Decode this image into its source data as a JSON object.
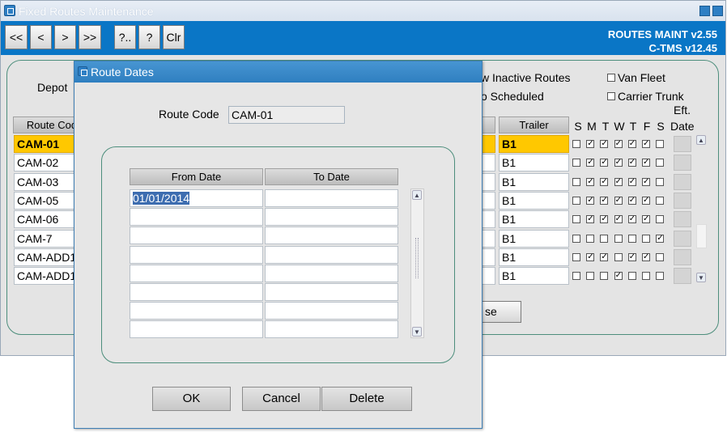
{
  "main_window": {
    "title": "Fixed Routes Maintenance",
    "toolbar": {
      "buttons": [
        "<<",
        "<",
        ">",
        ">>",
        "?..",
        "?",
        "Clr"
      ],
      "version_line1": "ROUTES  MAINT v2.55",
      "version_line2": "C-TMS v12.45"
    },
    "depot_label": "Depot",
    "show_inactive_label": "w Inactive Routes",
    "scheduled_label": "o Scheduled",
    "van_fleet_label": "Van Fleet",
    "carrier_trunk_label": "Carrier Trunk",
    "eft_date_label_1": "Eft.",
    "eft_date_label_2": "Date",
    "route_code_header": "Route Cod",
    "trailer_header": "Trailer",
    "days_header": [
      "S",
      "M",
      "T",
      "W",
      "T",
      "F",
      "S"
    ],
    "rows": [
      {
        "route": "CAM-01",
        "trailer": "B1",
        "days": [
          false,
          true,
          true,
          true,
          true,
          true,
          false
        ],
        "selected": true
      },
      {
        "route": "CAM-02",
        "trailer": "B1",
        "days": [
          false,
          true,
          true,
          true,
          true,
          true,
          false
        ],
        "selected": false
      },
      {
        "route": "CAM-03",
        "trailer": "B1",
        "days": [
          false,
          true,
          true,
          true,
          true,
          true,
          false
        ],
        "selected": false
      },
      {
        "route": "CAM-05",
        "trailer": "B1",
        "days": [
          false,
          true,
          true,
          true,
          true,
          true,
          false
        ],
        "selected": false
      },
      {
        "route": "CAM-06",
        "trailer": "B1",
        "days": [
          false,
          true,
          true,
          true,
          true,
          true,
          false
        ],
        "selected": false
      },
      {
        "route": "CAM-7",
        "trailer": "B1",
        "days": [
          false,
          false,
          false,
          false,
          false,
          false,
          true
        ],
        "selected": false
      },
      {
        "route": "CAM-ADD1",
        "trailer": "B1",
        "days": [
          false,
          true,
          true,
          false,
          true,
          true,
          false
        ],
        "selected": false
      },
      {
        "route": "CAM-ADD1",
        "trailer": "B1",
        "days": [
          false,
          false,
          false,
          true,
          false,
          false,
          false
        ],
        "selected": false
      }
    ],
    "partial_button_label": "se"
  },
  "dialog": {
    "title": "Route Dates",
    "route_code_label": "Route Code",
    "route_code_value": "CAM-01",
    "from_date_header": "From Date",
    "to_date_header": "To Date",
    "date_rows": [
      {
        "from": "01/01/2014",
        "to": ""
      },
      {
        "from": "",
        "to": ""
      },
      {
        "from": "",
        "to": ""
      },
      {
        "from": "",
        "to": ""
      },
      {
        "from": "",
        "to": ""
      },
      {
        "from": "",
        "to": ""
      },
      {
        "from": "",
        "to": ""
      },
      {
        "from": "",
        "to": ""
      }
    ],
    "ok_label": "OK",
    "cancel_label": "Cancel",
    "delete_label": "Delete"
  },
  "colors": {
    "toolbar_blue": "#0a76c6",
    "selected_row": "#ffc800",
    "panel_border": "#4d8e7c",
    "dialog_title": "#2f7fc0"
  },
  "icons": {
    "window_icon": "app-window-icon",
    "minimize": "minimize-icon",
    "maximize": "maximize-icon"
  }
}
